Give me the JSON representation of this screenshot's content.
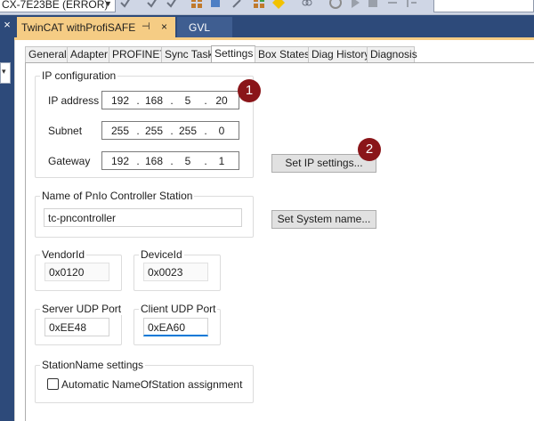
{
  "toolbar": {
    "config_selector": "CX-7E23BE (ERROR)"
  },
  "doc_tabs": [
    {
      "label": "TwinCAT withProfiSAFE",
      "pin_glyph": "⊣",
      "close_glyph": "×"
    },
    {
      "label": "GVL"
    }
  ],
  "prop_tabs": [
    "General",
    "Adapter",
    "PROFINET",
    "Sync Task",
    "Settings",
    "Box States",
    "Diag History",
    "Diagnosis"
  ],
  "ip_config": {
    "title": "IP configuration",
    "ip_label": "IP address",
    "ip": [
      "192",
      "168",
      "5",
      "20"
    ],
    "subnet_label": "Subnet",
    "subnet": [
      "255",
      "255",
      "255",
      "0"
    ],
    "gateway_label": "Gateway",
    "gateway": [
      "192",
      "168",
      "5",
      "1"
    ],
    "set_button": "Set IP settings..."
  },
  "station": {
    "title": "Name of PnIo Controller Station",
    "value": "tc-pncontroller",
    "set_button": "Set System name..."
  },
  "vendor": {
    "title": "VendorId",
    "value": "0x0120"
  },
  "device": {
    "title": "DeviceId",
    "value": "0x0023"
  },
  "server_port": {
    "title": "Server UDP Port",
    "value": "0xEE48"
  },
  "client_port": {
    "title": "Client UDP Port",
    "value": "0xEA60"
  },
  "station_name_settings": {
    "title": "StationName settings",
    "checkbox_label": "Automatic NameOfStation assignment",
    "checked": false
  },
  "badges": [
    "1",
    "2"
  ],
  "colors": {
    "tab_strip": "#2d4a7a",
    "active_doc_tab": "#f5cc84",
    "badge": "#8a1519",
    "focus_underline": "#0078d7"
  }
}
